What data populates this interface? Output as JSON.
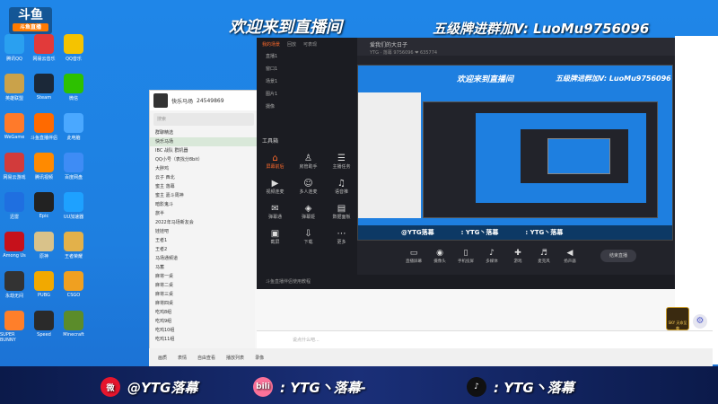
{
  "banner": {
    "logo": "斗鱼",
    "logo_sub": "斗鱼直播",
    "title": "欢迎来到直播间",
    "right": "五级牌进群加V: LuoMu9756096"
  },
  "desktop_icons": [
    {
      "label": "腾讯QQ",
      "color": "#2aa0f0"
    },
    {
      "label": "网易云音乐",
      "color": "#e23a3a"
    },
    {
      "label": "QQ音乐",
      "color": "#f5c300"
    },
    {
      "label": "英雄联盟",
      "color": "#caa24a"
    },
    {
      "label": "Steam",
      "color": "#1b2838"
    },
    {
      "label": "微信",
      "color": "#2dc100"
    },
    {
      "label": "WeGame",
      "color": "#ff7a2a"
    },
    {
      "label": "斗鱼直播伴侣",
      "color": "#ff6a00"
    },
    {
      "label": "此电脑",
      "color": "#4aa8ff"
    },
    {
      "label": "网易云游戏",
      "color": "#d23b3b"
    },
    {
      "label": "腾讯视频",
      "color": "#ff8a00"
    },
    {
      "label": "百度网盘",
      "color": "#3e8cf5"
    },
    {
      "label": "迅雷",
      "color": "#1f6fe0"
    },
    {
      "label": "Epic",
      "color": "#222"
    },
    {
      "label": "UU加速器",
      "color": "#1ea1ff"
    },
    {
      "label": "Among Us",
      "color": "#c6111b"
    },
    {
      "label": "原神",
      "color": "#d9c28a"
    },
    {
      "label": "王者荣耀",
      "color": "#e3b14a"
    },
    {
      "label": "永劫无间",
      "color": "#333"
    },
    {
      "label": "PUBG",
      "color": "#f2a900"
    },
    {
      "label": "CSGO",
      "color": "#f0a020"
    },
    {
      "label": "SUPER BUNNY",
      "color": "#ff7f2a"
    },
    {
      "label": "Speed",
      "color": "#2a2a2a"
    },
    {
      "label": "Minecraft",
      "color": "#5b8c2a"
    }
  ],
  "chat": {
    "name": "快乐马场",
    "id": "24549869",
    "search": "搜索",
    "rows": [
      "群聊精选",
      "快乐马场",
      "IBC 战队 群机器",
      "QQ小号（表找分8bit）",
      "大胖鸡",
      "云子 西北",
      "蜜主 落幕",
      "蜜主 嘉斗周神",
      "暗影鬼斗",
      "旅半",
      "2022年马场新友会",
      "娃娃吧",
      "王者1",
      "王者2",
      "马场通频道",
      "马蓄",
      "麻将一桌",
      "麻将二桌",
      "麻将三桌",
      "麻将四桌",
      "吃鸡8组",
      "吃鸡9组",
      "吃鸡10组",
      "吃鸡11组"
    ]
  },
  "obs": {
    "tabs": [
      "我的场景",
      "回放",
      "可表现"
    ],
    "scenes": [
      "直播1",
      "窗口1",
      "场景1",
      "图片1",
      "摄像"
    ],
    "tools_title": "工具箱",
    "tools": [
      {
        "label": "屏幕前后",
        "icon": "⌂",
        "hot": true
      },
      {
        "label": "房管助手",
        "icon": "♙",
        "hot": false
      },
      {
        "label": "主播任务",
        "icon": "☰",
        "hot": false
      },
      {
        "label": "视频连麦",
        "icon": "▶",
        "hot": false
      },
      {
        "label": "多人连麦",
        "icon": "☺",
        "hot": false
      },
      {
        "label": "语音推",
        "icon": "♫",
        "hot": false
      },
      {
        "label": "弹幕通",
        "icon": "✉",
        "hot": false
      },
      {
        "label": "弹幕姬",
        "icon": "◈",
        "hot": false
      },
      {
        "label": "数据面板",
        "icon": "▤",
        "hot": false
      },
      {
        "label": "截屏",
        "icon": "▣",
        "hot": false
      },
      {
        "label": "下载",
        "icon": "⇩",
        "hot": false
      },
      {
        "label": "更多",
        "icon": "⋯",
        "hot": false
      }
    ],
    "top_title": "爱我们的大日子",
    "top_info": "YTG · 落幕   9756096   ❤ 635774",
    "controls": [
      {
        "label": "直播屏幕",
        "icon": "▭"
      },
      {
        "label": "摄像头",
        "icon": "◉"
      },
      {
        "label": "手机投屏",
        "icon": "▯"
      },
      {
        "label": "多媒体",
        "icon": "♪"
      },
      {
        "label": "游戏",
        "icon": "✚"
      },
      {
        "label": "麦克风",
        "icon": "♬"
      },
      {
        "label": "扬声器",
        "icon": "◀"
      }
    ],
    "go_live": "结束直播",
    "bottom": "斗鱼直播伴侣使用教程"
  },
  "preview_footer": [
    "@YTG落幕",
    ": YTG丶落幕",
    ": YTG丶落幕"
  ],
  "input_placeholder": "说点什么吧...",
  "chat_toolbar": [
    "画质",
    "表情",
    "自由查看",
    "播放列表",
    "录像"
  ],
  "game_badge": "SKY 天命至尊",
  "footer": [
    {
      "label": "@YTG落幕",
      "icon": "微",
      "color": "#e6162d"
    },
    {
      "label": ": YTG丶落幕-",
      "icon": "bili",
      "color": "#fb7299"
    },
    {
      "label": ": YTG丶落幕",
      "icon": "♪",
      "color": "#111"
    }
  ]
}
